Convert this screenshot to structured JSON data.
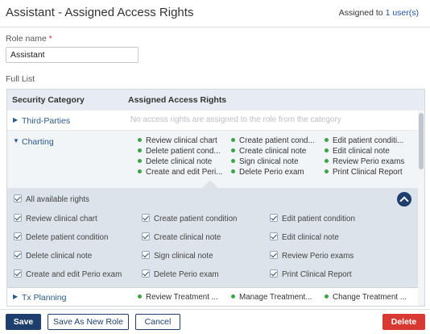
{
  "header": {
    "title": "Assistant - Assigned Access Rights",
    "assigned_prefix": "Assigned to ",
    "assigned_link": "1 user(s)"
  },
  "role": {
    "label": "Role name",
    "required_marker": "*",
    "value": "Assistant"
  },
  "full_list_label": "Full List",
  "table": {
    "col_category": "Security Category",
    "col_rights": "Assigned Access Rights",
    "third_parties": {
      "name": "Third-Parties",
      "empty_text": "No access rights are assigned to the role from the category"
    },
    "charting": {
      "name": "Charting",
      "rights": [
        "Review clinical chart",
        "Delete patient cond...",
        "Delete clinical note",
        "Create and edit Peri...",
        "Create patient cond...",
        "Create clinical note",
        "Sign clinical note",
        "Delete Perio exam",
        "Edit patient conditi...",
        "Edit clinical note",
        "Review Perio exams",
        "Print Clinical Report"
      ],
      "all_rights_label": "All available rights",
      "checkbox_rights": [
        "Review clinical chart",
        "Create patient condition",
        "Edit patient condition",
        "Delete patient condition",
        "Create clinical note",
        "Edit clinical note",
        "Delete clinical note",
        "Sign clinical note",
        "Review Perio exams",
        "Create and edit Perio exam",
        "Delete Perio exam",
        "Print Clinical Report"
      ]
    },
    "tx_planning": {
      "name": "Tx Planning",
      "rights": [
        "Review Treatment ...",
        "Manage Treatment...",
        "Change Treatment ..."
      ]
    }
  },
  "footer": {
    "save": "Save",
    "save_as_new": "Save As New Role",
    "cancel": "Cancel",
    "delete": "Delete"
  },
  "colors": {
    "primary": "#1e3f6e",
    "danger": "#d83a33",
    "link": "#1d57a8",
    "check_dot": "#3aa544"
  },
  "icons": {
    "caret_right": "caret-right-icon",
    "caret_down": "caret-down-icon",
    "collapse": "chevron-up-icon",
    "check": "checkmark-icon"
  }
}
